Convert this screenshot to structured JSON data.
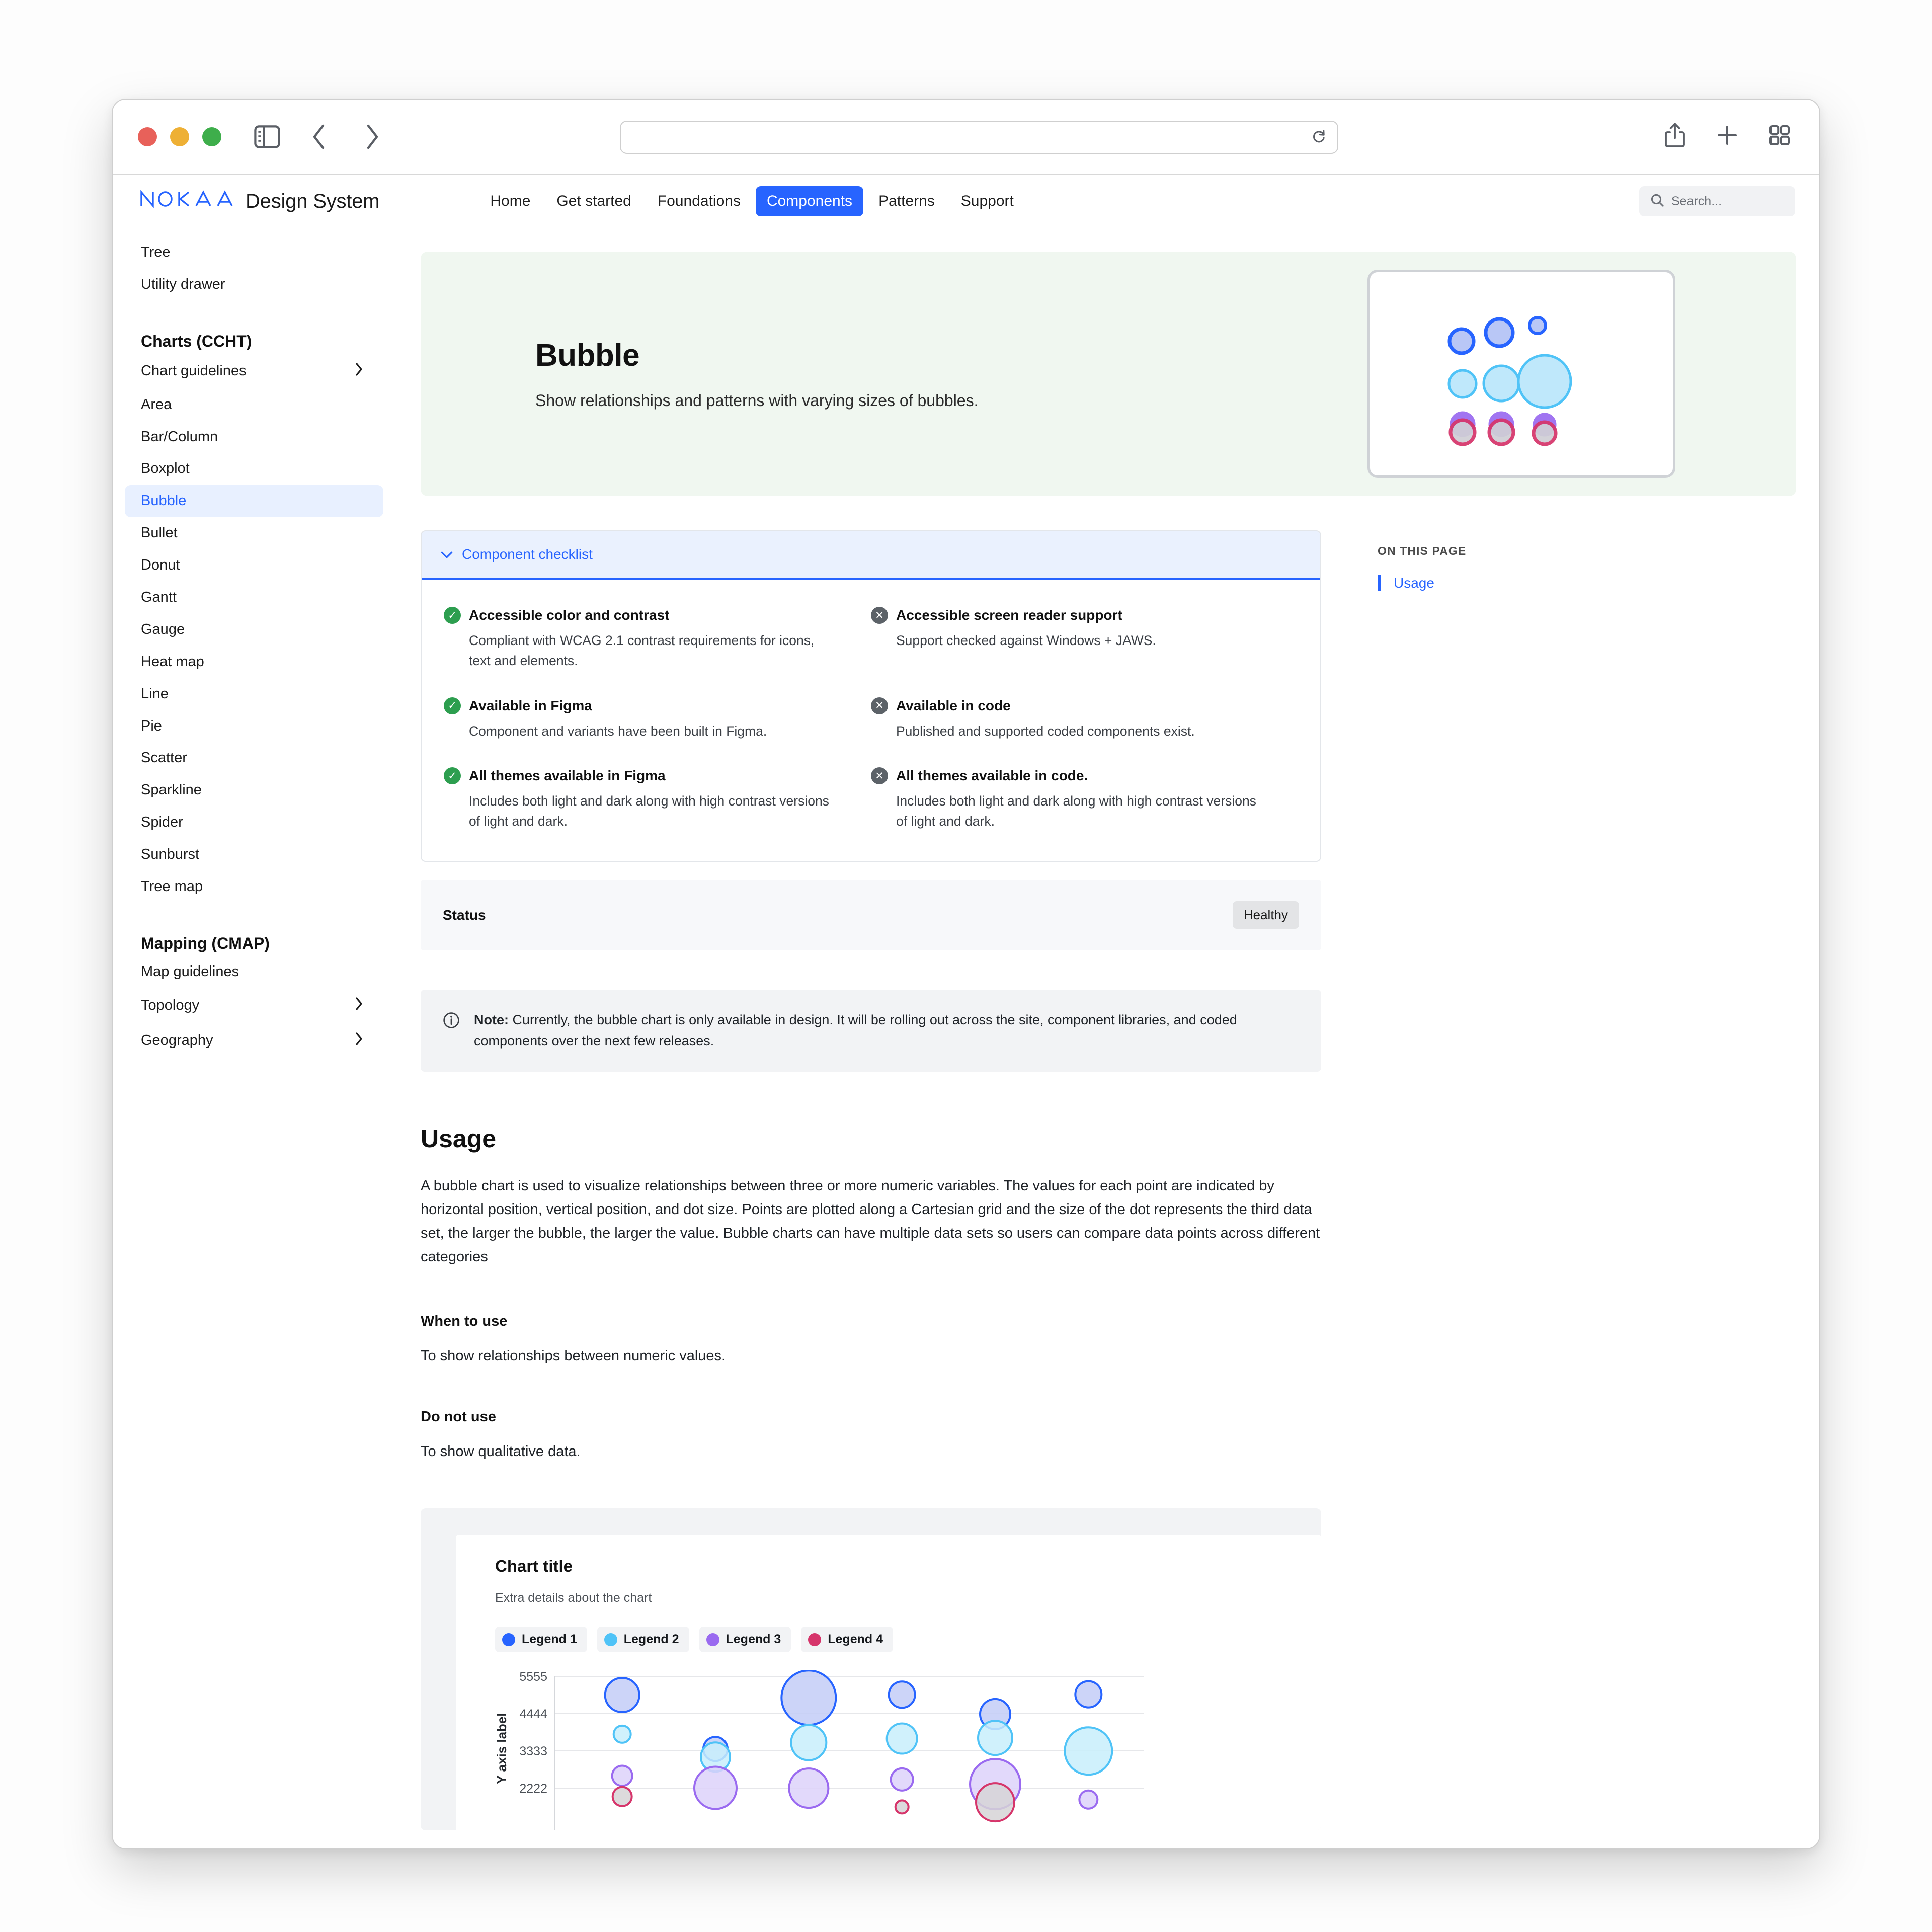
{
  "browser": {
    "traffic_lights": [
      "close",
      "minimize",
      "zoom"
    ],
    "sidebar_toggle_icon": "sidebar-icon",
    "back_icon": "chevron-left-icon",
    "forward_icon": "chevron-right-icon",
    "url_value": "",
    "reload_icon": "reload-icon",
    "share_icon": "share-icon",
    "newtab_icon": "plus-icon",
    "tabs_icon": "tab-overview-icon"
  },
  "header": {
    "brand_mark": "NOKIA",
    "brand_name": "Design System",
    "nav": [
      {
        "label": "Home",
        "active": false
      },
      {
        "label": "Get started",
        "active": false
      },
      {
        "label": "Foundations",
        "active": false
      },
      {
        "label": "Components",
        "active": true
      },
      {
        "label": "Patterns",
        "active": false
      },
      {
        "label": "Support",
        "active": false
      }
    ],
    "search_placeholder": "Search...",
    "search_icon": "search-icon"
  },
  "sidebar": {
    "top_items": [
      {
        "label": "Tree",
        "expandable": false,
        "active": false
      },
      {
        "label": "Utility drawer",
        "expandable": false,
        "active": false
      }
    ],
    "groups": [
      {
        "title": "Charts (CCHT)",
        "items": [
          {
            "label": "Chart guidelines",
            "expandable": true,
            "active": false
          },
          {
            "label": "Area",
            "expandable": false,
            "active": false
          },
          {
            "label": "Bar/Column",
            "expandable": false,
            "active": false
          },
          {
            "label": "Boxplot",
            "expandable": false,
            "active": false
          },
          {
            "label": "Bubble",
            "expandable": false,
            "active": true
          },
          {
            "label": "Bullet",
            "expandable": false,
            "active": false
          },
          {
            "label": "Donut",
            "expandable": false,
            "active": false
          },
          {
            "label": "Gantt",
            "expandable": false,
            "active": false
          },
          {
            "label": "Gauge",
            "expandable": false,
            "active": false
          },
          {
            "label": "Heat map",
            "expandable": false,
            "active": false
          },
          {
            "label": "Line",
            "expandable": false,
            "active": false
          },
          {
            "label": "Pie",
            "expandable": false,
            "active": false
          },
          {
            "label": "Scatter",
            "expandable": false,
            "active": false
          },
          {
            "label": "Sparkline",
            "expandable": false,
            "active": false
          },
          {
            "label": "Spider",
            "expandable": false,
            "active": false
          },
          {
            "label": "Sunburst",
            "expandable": false,
            "active": false
          },
          {
            "label": "Tree map",
            "expandable": false,
            "active": false
          }
        ]
      },
      {
        "title": "Mapping (CMAP)",
        "items": [
          {
            "label": "Map guidelines",
            "expandable": false,
            "active": false
          },
          {
            "label": "Topology",
            "expandable": true,
            "active": false
          },
          {
            "label": "Geography",
            "expandable": true,
            "active": false
          }
        ]
      }
    ]
  },
  "hero": {
    "title": "Bubble",
    "subtitle": "Show relationships and patterns with varying sizes of bubbles.",
    "preview_name": "bubble-chart-preview"
  },
  "checklist": {
    "header": "Component checklist",
    "collapse_icon": "chevron-down-icon",
    "items": [
      {
        "status": "ok",
        "title": "Accessible color and contrast",
        "desc": "Compliant with WCAG 2.1 contrast requirements for icons, text and elements."
      },
      {
        "status": "no",
        "title": "Accessible screen reader support",
        "desc": "Support checked against Windows + JAWS."
      },
      {
        "status": "ok",
        "title": "Available in Figma",
        "desc": "Component and variants have been built in Figma."
      },
      {
        "status": "no",
        "title": "Available in code",
        "desc": "Published and supported coded components exist."
      },
      {
        "status": "ok",
        "title": "All themes available in Figma",
        "desc": "Includes both light and dark along with high contrast versions of light and dark."
      },
      {
        "status": "no",
        "title": "All themes available in code.",
        "desc": "Includes both light and dark along with high contrast versions of light and dark."
      }
    ]
  },
  "status": {
    "label": "Status",
    "value": "Healthy"
  },
  "note": {
    "icon": "info-icon",
    "prefix": "Note:",
    "text": " Currently, the bubble chart is only available in design. It will be rolling out across the site, component libraries, and coded components over the next few releases."
  },
  "usage": {
    "heading": "Usage",
    "paragraph": "A bubble chart is used to visualize relationships between three or more numeric variables. The values for each point are indicated by horizontal position, vertical position, and dot size. Points are plotted along a Cartesian grid and the size of the dot represents the third data set, the larger the bubble, the larger the value. Bubble charts can have multiple data sets so users can compare data points across different categories",
    "when_heading": "When to use",
    "when_text": "To show relationships between numeric values.",
    "donot_heading": "Do not use",
    "donot_text": "To show qualitative data."
  },
  "toc": {
    "label": "ON THIS PAGE",
    "items": [
      {
        "label": "Usage",
        "active": true
      }
    ]
  },
  "chart_data": {
    "type": "scatter",
    "title": "Chart title",
    "subtitle": "Extra details about the chart",
    "xlabel": "",
    "ylabel": "Y axis label",
    "ytick_labels": [
      "5555",
      "4444",
      "3333",
      "2222"
    ],
    "ytick_values": [
      5555,
      4444,
      3333,
      2222
    ],
    "ylim": [
      1111,
      5555
    ],
    "grid": true,
    "legend_position": "top",
    "legend": [
      {
        "name": "Legend 1",
        "color": "#2764ff"
      },
      {
        "name": "Legend 2",
        "color": "#4fc3f7"
      },
      {
        "name": "Legend 3",
        "color": "#9a6af0"
      },
      {
        "name": "Legend 4",
        "color": "#d6356b"
      }
    ],
    "series": [
      {
        "name": "Legend 1",
        "color": "#2764ff",
        "points": [
          {
            "x": 1,
            "y": 5000,
            "r": 34
          },
          {
            "x": 3,
            "y": 4920,
            "r": 54
          },
          {
            "x": 4,
            "y": 5010,
            "r": 26
          },
          {
            "x": 5,
            "y": 4430,
            "r": 30
          },
          {
            "x": 6,
            "y": 5020,
            "r": 26
          },
          {
            "x": 2,
            "y": 3390,
            "r": 24
          }
        ]
      },
      {
        "name": "Legend 2",
        "color": "#4fc3f7",
        "points": [
          {
            "x": 1,
            "y": 3830,
            "r": 17
          },
          {
            "x": 2,
            "y": 3150,
            "r": 29
          },
          {
            "x": 3,
            "y": 3580,
            "r": 35
          },
          {
            "x": 4,
            "y": 3700,
            "r": 30
          },
          {
            "x": 5,
            "y": 3720,
            "r": 34
          },
          {
            "x": 6,
            "y": 3330,
            "r": 47
          }
        ]
      },
      {
        "name": "Legend 3",
        "color": "#9a6af0",
        "points": [
          {
            "x": 1,
            "y": 2590,
            "r": 20
          },
          {
            "x": 2,
            "y": 2230,
            "r": 42
          },
          {
            "x": 3,
            "y": 2220,
            "r": 39
          },
          {
            "x": 4,
            "y": 2480,
            "r": 22
          },
          {
            "x": 5,
            "y": 2340,
            "r": 50
          },
          {
            "x": 6,
            "y": 1880,
            "r": 18
          }
        ]
      },
      {
        "name": "Legend 4",
        "color": "#d6356b",
        "points": [
          {
            "x": 1,
            "y": 1970,
            "r": 19
          },
          {
            "x": 4,
            "y": 1660,
            "r": 13
          },
          {
            "x": 5,
            "y": 1800,
            "r": 38
          }
        ]
      }
    ]
  }
}
